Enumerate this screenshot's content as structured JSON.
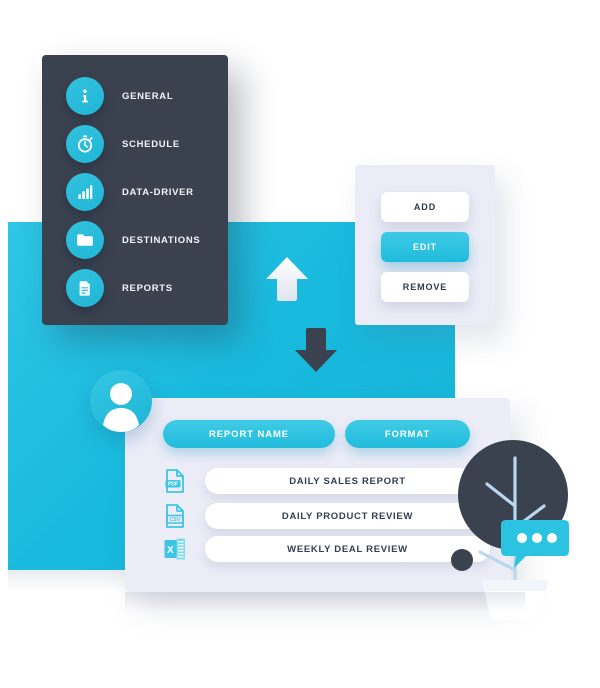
{
  "sidebar": {
    "items": [
      {
        "label": "GENERAL",
        "icon": "info-icon"
      },
      {
        "label": "SCHEDULE",
        "icon": "stopwatch-icon"
      },
      {
        "label": "DATA-DRIVER",
        "icon": "bar-chart-icon"
      },
      {
        "label": "DESTINATIONS",
        "icon": "folder-icon"
      },
      {
        "label": "REPORTS",
        "icon": "document-icon"
      }
    ]
  },
  "actions": {
    "add_label": "ADD",
    "edit_label": "EDIT",
    "remove_label": "REMOVE"
  },
  "report_table": {
    "headers": {
      "name": "REPORT NAME",
      "format": "FORMAT"
    },
    "rows": [
      {
        "name": "DAILY SALES REPORT",
        "format": "PDF",
        "icon": "pdf-file-icon"
      },
      {
        "name": "DAILY PRODUCT REVIEW",
        "format": "CSV",
        "icon": "csv-file-icon"
      },
      {
        "name": "WEEKLY DEAL REVIEW",
        "format": "EXCEL",
        "icon": "excel-file-icon"
      }
    ]
  },
  "decor": {
    "upload_arrow": "upload-arrow-icon",
    "download_arrow": "download-arrow-icon",
    "avatar": "user-avatar-icon",
    "plant": "plant-icon",
    "chat": "chat-bubble-icon"
  },
  "colors": {
    "accent_cyan": "#21bcdd",
    "dark_navy": "#3a4250",
    "panel_lavender": "#ededf8",
    "white": "#ffffff"
  }
}
